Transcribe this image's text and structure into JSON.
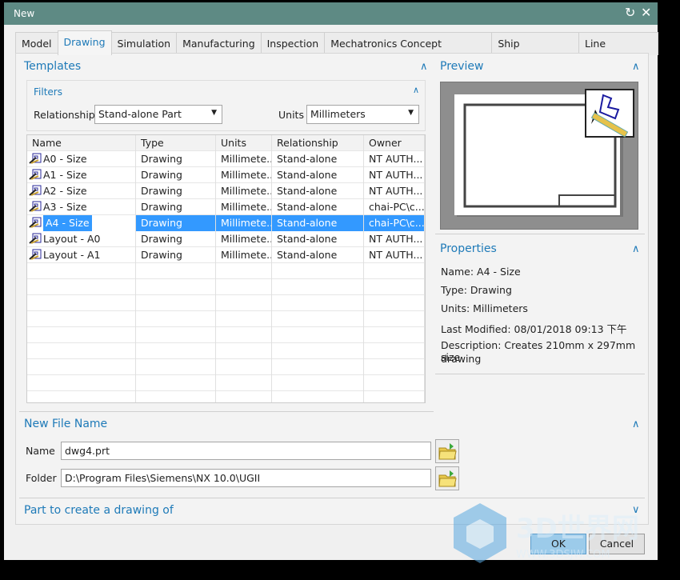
{
  "window": {
    "title": "New"
  },
  "tabs": [
    {
      "label": "Model"
    },
    {
      "label": "Drawing",
      "active": true
    },
    {
      "label": "Simulation"
    },
    {
      "label": "Manufacturing"
    },
    {
      "label": "Inspection"
    },
    {
      "label": "Mechatronics Concept Designer"
    },
    {
      "label": "Ship Structures"
    },
    {
      "label": "Line Designer"
    }
  ],
  "templates": {
    "title": "Templates",
    "filters": {
      "title": "Filters",
      "relationship_label": "Relationship",
      "relationship_value": "Stand-alone Part",
      "units_label": "Units",
      "units_value": "Millimeters"
    },
    "columns": [
      "Name",
      "Type",
      "Units",
      "Relationship",
      "Owner"
    ],
    "rows": [
      {
        "name": "A0 - Size",
        "type": "Drawing",
        "units": "Millimete...",
        "relationship": "Stand-alone",
        "owner": "NT AUTH..."
      },
      {
        "name": "A1 - Size",
        "type": "Drawing",
        "units": "Millimete...",
        "relationship": "Stand-alone",
        "owner": "NT AUTH..."
      },
      {
        "name": "A2 - Size",
        "type": "Drawing",
        "units": "Millimete...",
        "relationship": "Stand-alone",
        "owner": "NT AUTH..."
      },
      {
        "name": "A3 - Size",
        "type": "Drawing",
        "units": "Millimete...",
        "relationship": "Stand-alone",
        "owner": "chai-PC\\c..."
      },
      {
        "name": "A4 - Size",
        "type": "Drawing",
        "units": "Millimete...",
        "relationship": "Stand-alone",
        "owner": "chai-PC\\c...",
        "selected": true
      },
      {
        "name": "Layout - A0",
        "type": "Drawing",
        "units": "Millimete...",
        "relationship": "Stand-alone",
        "owner": "NT AUTH..."
      },
      {
        "name": "Layout - A1",
        "type": "Drawing",
        "units": "Millimete...",
        "relationship": "Stand-alone",
        "owner": "NT AUTH..."
      }
    ]
  },
  "preview": {
    "title": "Preview"
  },
  "properties": {
    "title": "Properties",
    "name": "Name: A4 - Size",
    "type": "Type: Drawing",
    "units": "Units: Millimeters",
    "last_modified": "Last Modified: 08/01/2018 09:13 下午",
    "description_line1": "Description: Creates 210mm x 297mm size",
    "description_line2": "drawing"
  },
  "new_file": {
    "title": "New File Name",
    "name_label": "Name",
    "name_value": "dwg4.prt",
    "folder_label": "Folder",
    "folder_value": "D:\\Program Files\\Siemens\\NX 10.0\\UGII"
  },
  "part_section": {
    "title": "Part to create a drawing of"
  },
  "buttons": {
    "ok": "OK",
    "cancel": "Cancel"
  },
  "watermark": {
    "text": "3D世界网",
    "url": "WWW.3DSJW.COM"
  },
  "colors": {
    "titlebar": "#5e8a84",
    "accent": "#1e7ab8",
    "selection": "#3399ff"
  }
}
